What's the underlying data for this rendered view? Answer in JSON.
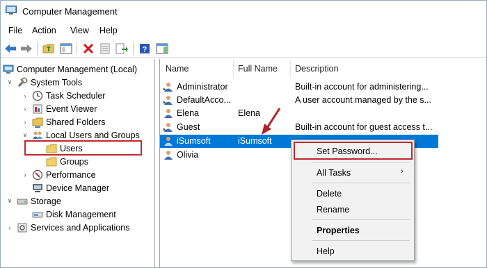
{
  "window": {
    "title": "Computer Management"
  },
  "menu": [
    "File",
    "Action",
    "View",
    "Help"
  ],
  "tree": [
    {
      "label": "Computer Management (Local)",
      "level": 0,
      "expanded": true,
      "icon": "computer-icon"
    },
    {
      "label": "System Tools",
      "level": 1,
      "expanded": true,
      "icon": "tools-icon"
    },
    {
      "label": "Task Scheduler",
      "level": 2,
      "expanded": false,
      "icon": "clock-icon"
    },
    {
      "label": "Event Viewer",
      "level": 2,
      "expanded": false,
      "icon": "event-viewer-icon"
    },
    {
      "label": "Shared Folders",
      "level": 2,
      "expanded": false,
      "icon": "shared-folder-icon"
    },
    {
      "label": "Local Users and Groups",
      "level": 2,
      "expanded": true,
      "icon": "users-group-icon"
    },
    {
      "label": "Users",
      "level": 3,
      "selected": true,
      "icon": "folder-icon"
    },
    {
      "label": "Groups",
      "level": 3,
      "icon": "folder-icon"
    },
    {
      "label": "Performance",
      "level": 2,
      "expanded": false,
      "icon": "performance-icon"
    },
    {
      "label": "Device Manager",
      "level": 2,
      "icon": "device-manager-icon"
    },
    {
      "label": "Storage",
      "level": 1,
      "expanded": true,
      "icon": "storage-icon"
    },
    {
      "label": "Disk Management",
      "level": 2,
      "icon": "disk-icon"
    },
    {
      "label": "Services and Applications",
      "level": 1,
      "expanded": false,
      "icon": "services-icon"
    }
  ],
  "list": {
    "columns": [
      "Name",
      "Full Name",
      "Description"
    ],
    "rows": [
      {
        "name": "Administrator",
        "full_name": "",
        "description": "Built-in account for administering..."
      },
      {
        "name": "DefaultAcco...",
        "full_name": "",
        "description": "A user account managed by the s..."
      },
      {
        "name": "Elena",
        "full_name": "Elena",
        "description": ""
      },
      {
        "name": "Guest",
        "full_name": "",
        "description": "Built-in account for guest access t..."
      },
      {
        "name": "iSumsoft",
        "full_name": "iSumsoft",
        "description": "",
        "selected": true
      },
      {
        "name": "Olivia",
        "full_name": "",
        "description": ""
      }
    ]
  },
  "context_menu": {
    "items": [
      {
        "label": "Set Password...",
        "highlighted": true
      },
      {
        "label": "All Tasks",
        "submenu": true
      },
      {
        "label": "Delete"
      },
      {
        "label": "Rename"
      },
      {
        "label": "Properties",
        "bold": true
      },
      {
        "label": "Help"
      }
    ]
  },
  "colors": {
    "selection": "#0078d7",
    "annotation": "#c0282d",
    "toolbar_icon": "#2f79c9"
  }
}
